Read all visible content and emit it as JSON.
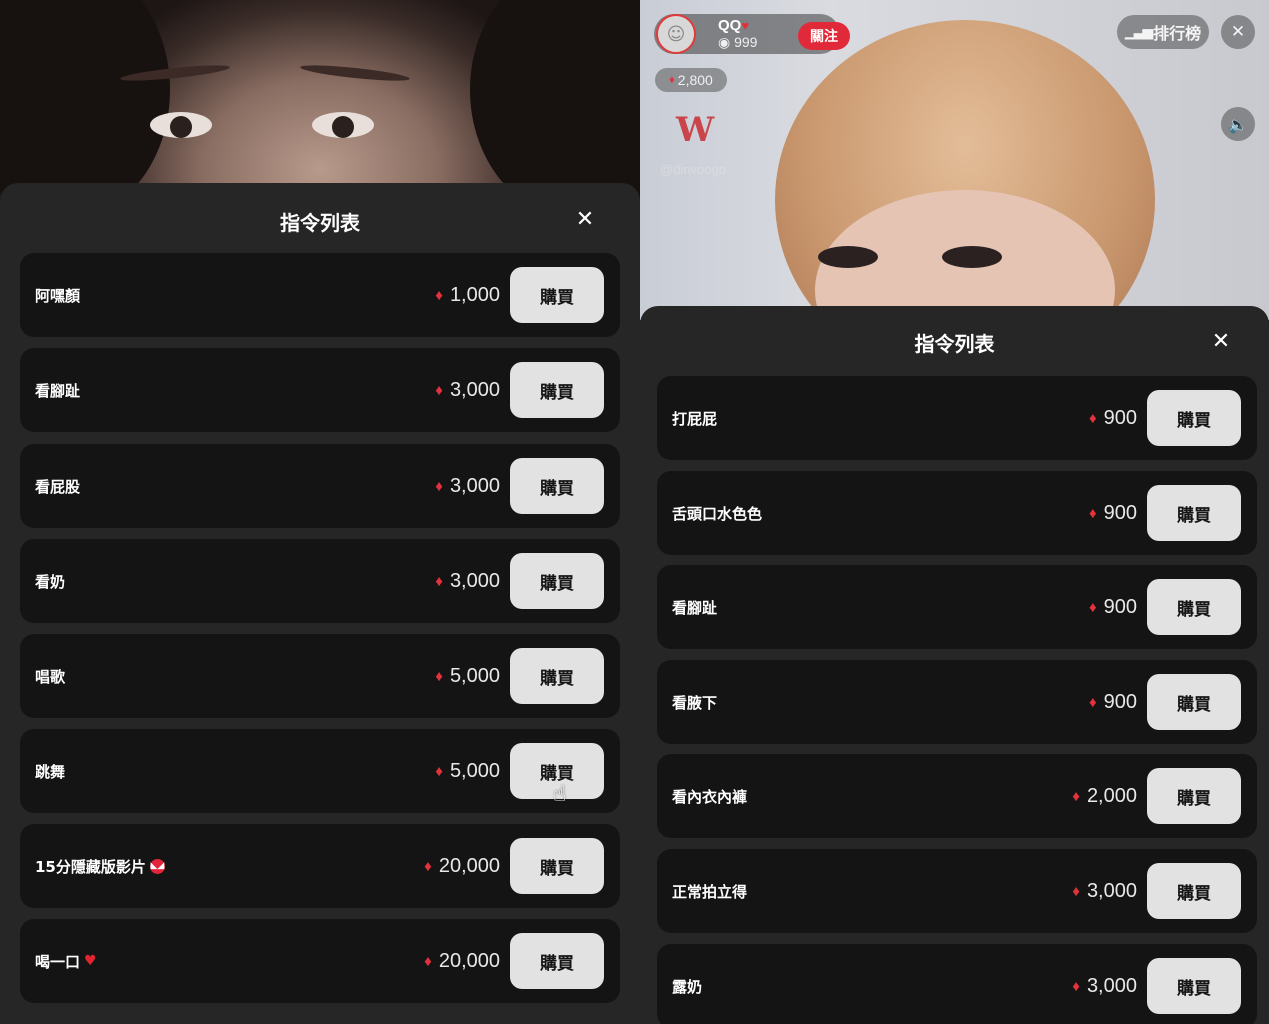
{
  "left": {
    "title": "指令列表",
    "close_symbol": "✕",
    "items": [
      {
        "name": "阿嘿顏",
        "price": "1,000",
        "button": "購買"
      },
      {
        "name": "看腳趾",
        "price": "3,000",
        "button": "購買"
      },
      {
        "name": "看屁股",
        "price": "3,000",
        "button": "購買"
      },
      {
        "name": "看奶",
        "price": "3,000",
        "button": "購買"
      },
      {
        "name": "唱歌",
        "price": "5,000",
        "button": "購買"
      },
      {
        "name": "跳舞",
        "price": "5,000",
        "button": "購買"
      },
      {
        "name": "15分隱藏版影片",
        "price": "20,000",
        "button": "購買",
        "emoji": "devil-emoji"
      },
      {
        "name": "喝一口",
        "price": "20,000",
        "button": "購買",
        "emoji": "heart-emoji"
      }
    ]
  },
  "right": {
    "host": {
      "name": "QQ",
      "viewers": "999",
      "follow_label": "關注"
    },
    "gems": "2,800",
    "watermark": "@dinvoogo",
    "rank_label": "排行榜",
    "title": "指令列表",
    "close_symbol": "✕",
    "items": [
      {
        "name": "打屁屁",
        "price": "900",
        "button": "購買"
      },
      {
        "name": "舌頭口水色色",
        "price": "900",
        "button": "購買"
      },
      {
        "name": "看腳趾",
        "price": "900",
        "button": "購買"
      },
      {
        "name": "看腋下",
        "price": "900",
        "button": "購買"
      },
      {
        "name": "看內衣內褲",
        "price": "2,000",
        "button": "購買"
      },
      {
        "name": "正常拍立得",
        "price": "3,000",
        "button": "購買"
      },
      {
        "name": "露奶",
        "price": "3,000",
        "button": "購買"
      }
    ]
  },
  "colors": {
    "accent_red": "#e02a3a",
    "sheet_bg": "#262626",
    "row_bg": "#141414",
    "button_bg": "#e2e2e2"
  }
}
